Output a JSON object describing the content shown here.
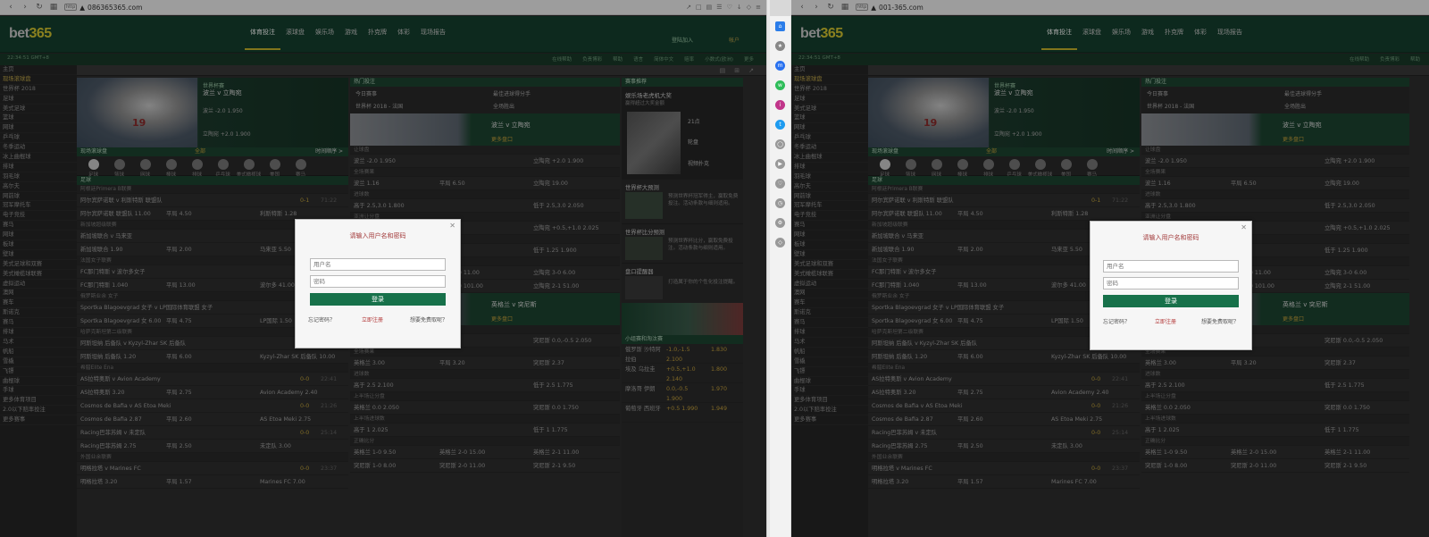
{
  "left_window": {
    "url": "086365365.com",
    "nav": [
      "体育投注",
      "滚球盘",
      "娱乐场",
      "游戏",
      "扑克牌",
      "体彩",
      "现场报告"
    ],
    "header_links": [
      "登陆加入",
      "帐户"
    ],
    "clock": "22:34:51 GMT+8",
    "subbar": [
      "在线帮助",
      "负责博彩",
      "帮助",
      "语言",
      "简体中文",
      "赔率",
      "小数式(欧洲)",
      "更多"
    ]
  },
  "right_window": {
    "url": "001-365.com",
    "nav": [
      "体育投注",
      "滚球盘",
      "娱乐场",
      "游戏",
      "扑克牌",
      "体彩",
      "现场报告"
    ],
    "clock": "22:34:51 GMT+8",
    "subbar": [
      "在线帮助",
      "负责博彩",
      "帮助"
    ]
  },
  "brand": {
    "bet": "bet",
    "num": "365"
  },
  "sidebar": [
    "主页",
    "现场滚球盘",
    "世界杯 2018",
    "足球",
    "美式足球",
    "篮球",
    "网球",
    "乒乓球",
    "冬季运动",
    "冰上曲棍球",
    "排球",
    "羽毛球",
    "高尔夫",
    "网前球",
    "冠军摩托车",
    "电子竞技",
    "赛马",
    "网球",
    "板球",
    "壁球",
    "美式足球和双赛",
    "美式橄榄球联赛",
    "虚拟运动",
    "澳网",
    "赛车",
    "斯诺克",
    "赛马",
    "排球",
    "马术",
    "帆船",
    "雪橇",
    "飞镖",
    "曲棍球",
    "手球",
    "更多体育项目",
    "2.0以下赔率投注",
    "更多赛事"
  ],
  "banner1": {
    "tag": "世界杯赛",
    "title": "波兰 v 立陶宛",
    "o1": "波兰 -2.0 1.950",
    "o2": "立陶宛 +2.0 1.900"
  },
  "live": {
    "title": "现场滚球盘",
    "count": "全部",
    "more": "时间顺序 >"
  },
  "sports_icons": [
    "足球",
    "篮球",
    "网球",
    "棒球",
    "排球",
    "乒乓球",
    "美式橄榄球联赛",
    "美国",
    "赛马"
  ],
  "section_football": "足球",
  "rows": [
    {
      "g": "阿根廷Primera B联赛"
    },
    {
      "match": "阿尔宾萨诺联 v 利斯特斯 联盟队",
      "score": "0-1",
      "time": "71:22"
    },
    {
      "a": "阿尔宾萨诺联 联盟队 11.00",
      "d": "平局 4.50",
      "b": "利斯特斯 1.28"
    },
    {
      "g": "新加坡超级联赛"
    },
    {
      "match": "新加坡联合 v 马来亚",
      "score": "0-0",
      "time": "08:10"
    },
    {
      "a": "新加坡联合 1.90",
      "d": "平局 2.00",
      "b": "马来亚 5.50"
    },
    {
      "g": "法国女子联赛"
    },
    {
      "match": "FC那门特斯 v 波尔多女子",
      "score": "0-0",
      "time": "12:11"
    },
    {
      "a": "FC那门特斯 1.040",
      "d": "平局 13.00",
      "b": "波尔多 41.00"
    },
    {
      "g": "俄罗斯业余 女子"
    },
    {
      "match": "Sportka Blagoevgrad 女子 v LP国际体育联盟 女子",
      "score": "0-0",
      "time": "31:50"
    },
    {
      "a": "Sportka Blagoevgrad 女 6.00",
      "d": "平局 4.75",
      "b": "LP国际 1.50"
    },
    {
      "g": "哈萨克斯坦第二级联赛"
    },
    {
      "match": "阿斯坦纳 后备队 v Kyzyl-Zhar SK 后备队",
      "score": "1-1",
      "time": "45:00"
    },
    {
      "a": "阿斯坦纳 后备队 1.20",
      "d": "平局 6.00",
      "b": "Kyzyl-Zhar SK 后备队 10.00"
    },
    {
      "g": "希腊Elite Ena"
    },
    {
      "match": "AS拉特奥斯 v Avion Academy",
      "score": "0-0",
      "time": "22:41"
    },
    {
      "a": "AS拉特奥斯 3.20",
      "d": "平局 2.75",
      "b": "Avion Academy 2.40"
    },
    {
      "match": "Cosmos de Bafia v AS Etoa Meki",
      "score": "0-0",
      "time": "21:26"
    },
    {
      "a": "Cosmos de Bafia 2.87",
      "d": "平局 2.60",
      "b": "AS Etoa Meki 2.75"
    },
    {
      "match": "Racing巴菲苏姆 v 未定队",
      "score": "0-0",
      "time": "25:14"
    },
    {
      "a": "Racing巴菲苏姆 2.75",
      "d": "平局 2.50",
      "b": "未定队 3.00"
    },
    {
      "g": "外国业余联赛"
    },
    {
      "match": "明格拉塔 v Marines FC",
      "score": "0-0",
      "time": "23:37"
    },
    {
      "a": "明格拉塔 3.20",
      "d": "平局 1.57",
      "b": "Marines FC 7.00"
    }
  ],
  "popular": {
    "title": "热门投注",
    "links": [
      "今日赛事",
      "世界杯 2018 - 法国",
      "最佳进球得分手",
      "全场胜出"
    ],
    "banner_title": "波兰 v 立陶宛",
    "more": "更多盘口",
    "markets": [
      {
        "g": "让球盘"
      },
      {
        "a": "波兰 -2.0 1.950",
        "b": "立陶宛 +2.0 1.900"
      },
      {
        "g": "全场赛果"
      },
      {
        "a": "波兰 1.16",
        "d": "平局 6.50",
        "b": "立陶宛 19.00"
      },
      {
        "g": "进球数"
      },
      {
        "a": "高于 2.5,3.0 1.800",
        "b": "低于 2.5,3.0 2.050"
      },
      {
        "g": "亚洲让分盘"
      },
      {
        "a": "波兰 -0.5,-1.0 1.925",
        "b": "立陶宛 +0.5,+1.0 2.025"
      },
      {
        "g": "上半场进球数"
      },
      {
        "a": "高于 1.25 1.950",
        "b": "低于 1.25 1.900"
      },
      {
        "g": "正确比分"
      },
      {
        "a": "波兰 2-0 5.00",
        "d": "平局 0-0 11.00",
        "b": "立陶宛 3-0 6.00"
      },
      {
        "a": "波兰 3-0 6.00",
        "d": "波兰 2-0 101.00",
        "b": "立陶宛 2-1 51.00"
      }
    ],
    "markets2": [
      {
        "g": "让球"
      },
      {
        "a": "英格兰 0.0,+0.5 1.800",
        "b": "突尼斯 0.0,-0.5 2.050"
      },
      {
        "g": "全场赛果"
      },
      {
        "a": "英格兰 3.00",
        "d": "平局 3.20",
        "b": "突尼斯 2.37"
      },
      {
        "g": "进球数"
      },
      {
        "a": "高于 2.5 2.100",
        "b": "低于 2.5 1.775"
      },
      {
        "g": "上半场让分盘"
      },
      {
        "a": "英格兰 0.0 2.050",
        "b": "突尼斯 0.0 1.750"
      },
      {
        "g": "上半场进球数"
      },
      {
        "a": "高于 1 2.025",
        "b": "低于 1 1.775"
      },
      {
        "g": "正确比分"
      },
      {
        "a": "英格兰 1-0 9.50",
        "d": "英格兰 2-0 15.00",
        "b": "英格兰 2-1 11.00"
      },
      {
        "a": "突尼斯 1-0 8.00",
        "d": "突尼斯 2-0 11.00",
        "b": "突尼斯 2-1 9.50"
      }
    ],
    "banner2_title": "英格兰 v 突尼斯",
    "banner3_title": "亚伯罗 v 维多利亚"
  },
  "right_col": {
    "title": "赛事推荐",
    "casino_title": "娱乐场老虎机大奖",
    "casino_sub": "赢得超过大奖金额",
    "items": [
      "21点",
      "轮盘",
      "视频扑克"
    ],
    "news1_title": "世界杯大预测",
    "news1_text": "预测世界杯冠军得主，赢取免费投注。活动条款与细则适用。",
    "news2_title": "世界杯比分预测",
    "news2_text": "预测世界杯比分，赢取免费投注。活动条款与细则适用。",
    "news3_title": "盘口提醒器",
    "news3_text": "打造属于你的个性化投注提醒。",
    "odds_title": "小组赛和淘汰赛",
    "odds_rows": [
      {
        "t": "俄罗斯 沙特阿拉伯",
        "v1": "-1.0,-1.5 2.100",
        "v2": "1.830"
      },
      {
        "t": "埃及 乌拉圭",
        "v1": "+0.5,+1.0 2.140",
        "v2": "1.800"
      },
      {
        "t": "摩洛哥 伊朗",
        "v1": "0.0,-0.5 1.900",
        "v2": "1.970"
      },
      {
        "t": "葡萄牙 西班牙",
        "v1": "+0.5 1.990",
        "v2": "1.949"
      }
    ]
  },
  "login_modal": {
    "title": "请输入用户名和密码",
    "username_placeholder": "用户名",
    "password_placeholder": "密码",
    "login_button": "登录",
    "forgot": "忘记密码？",
    "register": "立即注册",
    "free_bet": "想要免费取呢？"
  },
  "colors": {
    "brand_green": "#14402e",
    "accent_yellow": "#d4c530",
    "button_green": "#17714a"
  }
}
